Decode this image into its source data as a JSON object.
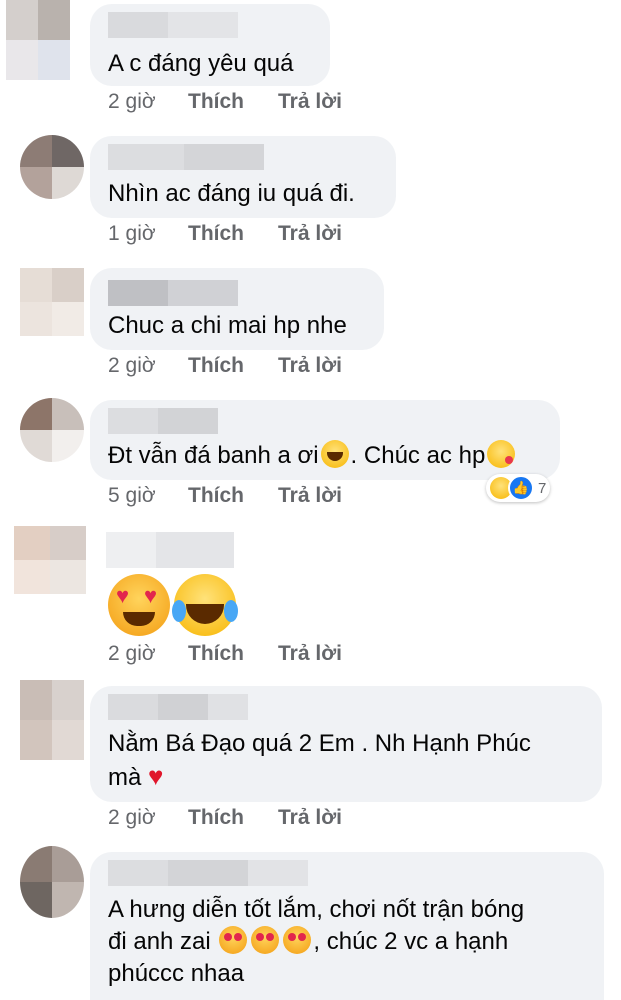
{
  "actions": {
    "like": "Thích",
    "reply": "Trả lời"
  },
  "comments": [
    {
      "text": "A c đáng yêu quá",
      "time": "2 giờ"
    },
    {
      "text": "Nhìn ac đáng iu quá đi.",
      "time": "1 giờ"
    },
    {
      "text": "Chuc a chi mai hp nhe",
      "time": "2 giờ"
    },
    {
      "text_a": "Đt vẫn đá banh a ơi",
      "text_b": ". Chúc ac hp",
      "time": "5 giờ",
      "reaction_count": "7"
    },
    {
      "time": "2 giờ"
    },
    {
      "text_a": "Nằm Bá Đạo quá 2 Em . Nh Hạnh Phúc",
      "text_b": "mà",
      "time": "2 giờ"
    },
    {
      "text_a": "A hưng diễn tốt lắm, chơi nốt trận bóng",
      "text_b": "đi anh zai",
      "text_c": ", chúc 2 vc a hạnh",
      "text_d": "phúccc nhaa"
    }
  ]
}
